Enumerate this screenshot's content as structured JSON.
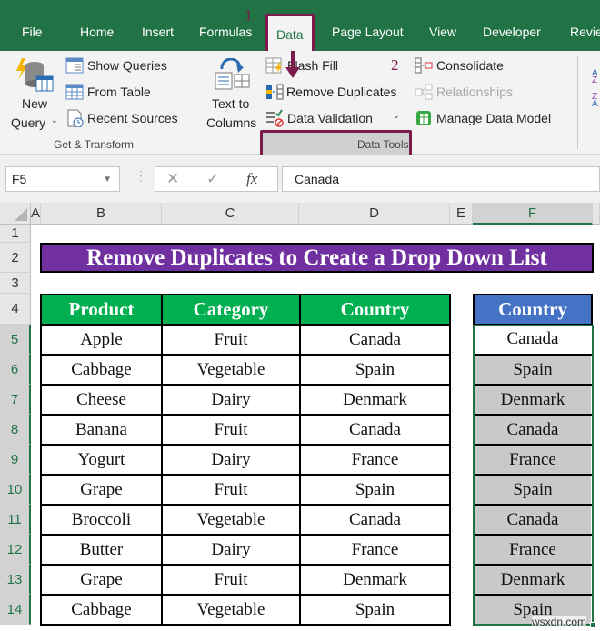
{
  "ribbon_tabs": [
    {
      "label": "File",
      "active": false
    },
    {
      "label": "Home",
      "active": false
    },
    {
      "label": "Insert",
      "active": false
    },
    {
      "label": "Formulas",
      "active": false
    },
    {
      "label": "Data",
      "active": true
    },
    {
      "label": "Page Layout",
      "active": false
    },
    {
      "label": "View",
      "active": false
    },
    {
      "label": "Developer",
      "active": false
    },
    {
      "label": "Revie",
      "active": false
    }
  ],
  "annotations": {
    "step1": "1",
    "step2": "2",
    "accent_color": "#7b1a4b"
  },
  "ribbon": {
    "get_transform": {
      "new_query_line1": "New",
      "new_query_line2": "Query",
      "show_queries": "Show Queries",
      "from_table": "From Table",
      "recent_sources": "Recent Sources",
      "group_label": "Get & Transform"
    },
    "data_tools": {
      "text_to_columns_line1": "Text to",
      "text_to_columns_line2": "Columns",
      "flash_fill": "Flash Fill",
      "remove_duplicates": "Remove Duplicates",
      "data_validation": "Data Validation",
      "consolidate": "Consolidate",
      "relationships": "Relationships",
      "manage_data_model": "Manage Data Model",
      "group_label": "Data Tools"
    }
  },
  "formula_bar": {
    "name_box": "F5",
    "cancel_icon": "✕",
    "enter_icon": "✓",
    "fx_label": "fx",
    "value": "Canada"
  },
  "columns": [
    "A",
    "B",
    "C",
    "D",
    "E",
    "F"
  ],
  "selected_column": "F",
  "rows": [
    "1",
    "2",
    "3",
    "4",
    "5",
    "6",
    "7",
    "8",
    "9",
    "10",
    "11",
    "12",
    "13",
    "14"
  ],
  "sheet": {
    "title": "Remove Duplicates to Create a Drop Down List",
    "title_color": "#7030a0",
    "table": {
      "header_color": "#00b050",
      "headers": [
        "Product",
        "Category",
        "Country"
      ],
      "rows": [
        [
          "Apple",
          "Fruit",
          "Canada"
        ],
        [
          "Cabbage",
          "Vegetable",
          "Spain"
        ],
        [
          "Cheese",
          "Dairy",
          "Denmark"
        ],
        [
          "Banana",
          "Fruit",
          "Canada"
        ],
        [
          "Yogurt",
          "Dairy",
          "France"
        ],
        [
          "Grape",
          "Fruit",
          "Spain"
        ],
        [
          "Broccoli",
          "Vegetable",
          "Canada"
        ],
        [
          "Butter",
          "Dairy",
          "France"
        ],
        [
          "Grape",
          "Fruit",
          "Denmark"
        ],
        [
          "Cabbage",
          "Vegetable",
          "Spain"
        ]
      ]
    },
    "unique_list": {
      "header_color": "#4472c4",
      "header": "Country",
      "values": [
        "Canada",
        "Spain",
        "Denmark",
        "Canada",
        "France",
        "Spain",
        "Canada",
        "France",
        "Denmark",
        "Spain"
      ]
    }
  },
  "watermark": "wsxdn.com"
}
